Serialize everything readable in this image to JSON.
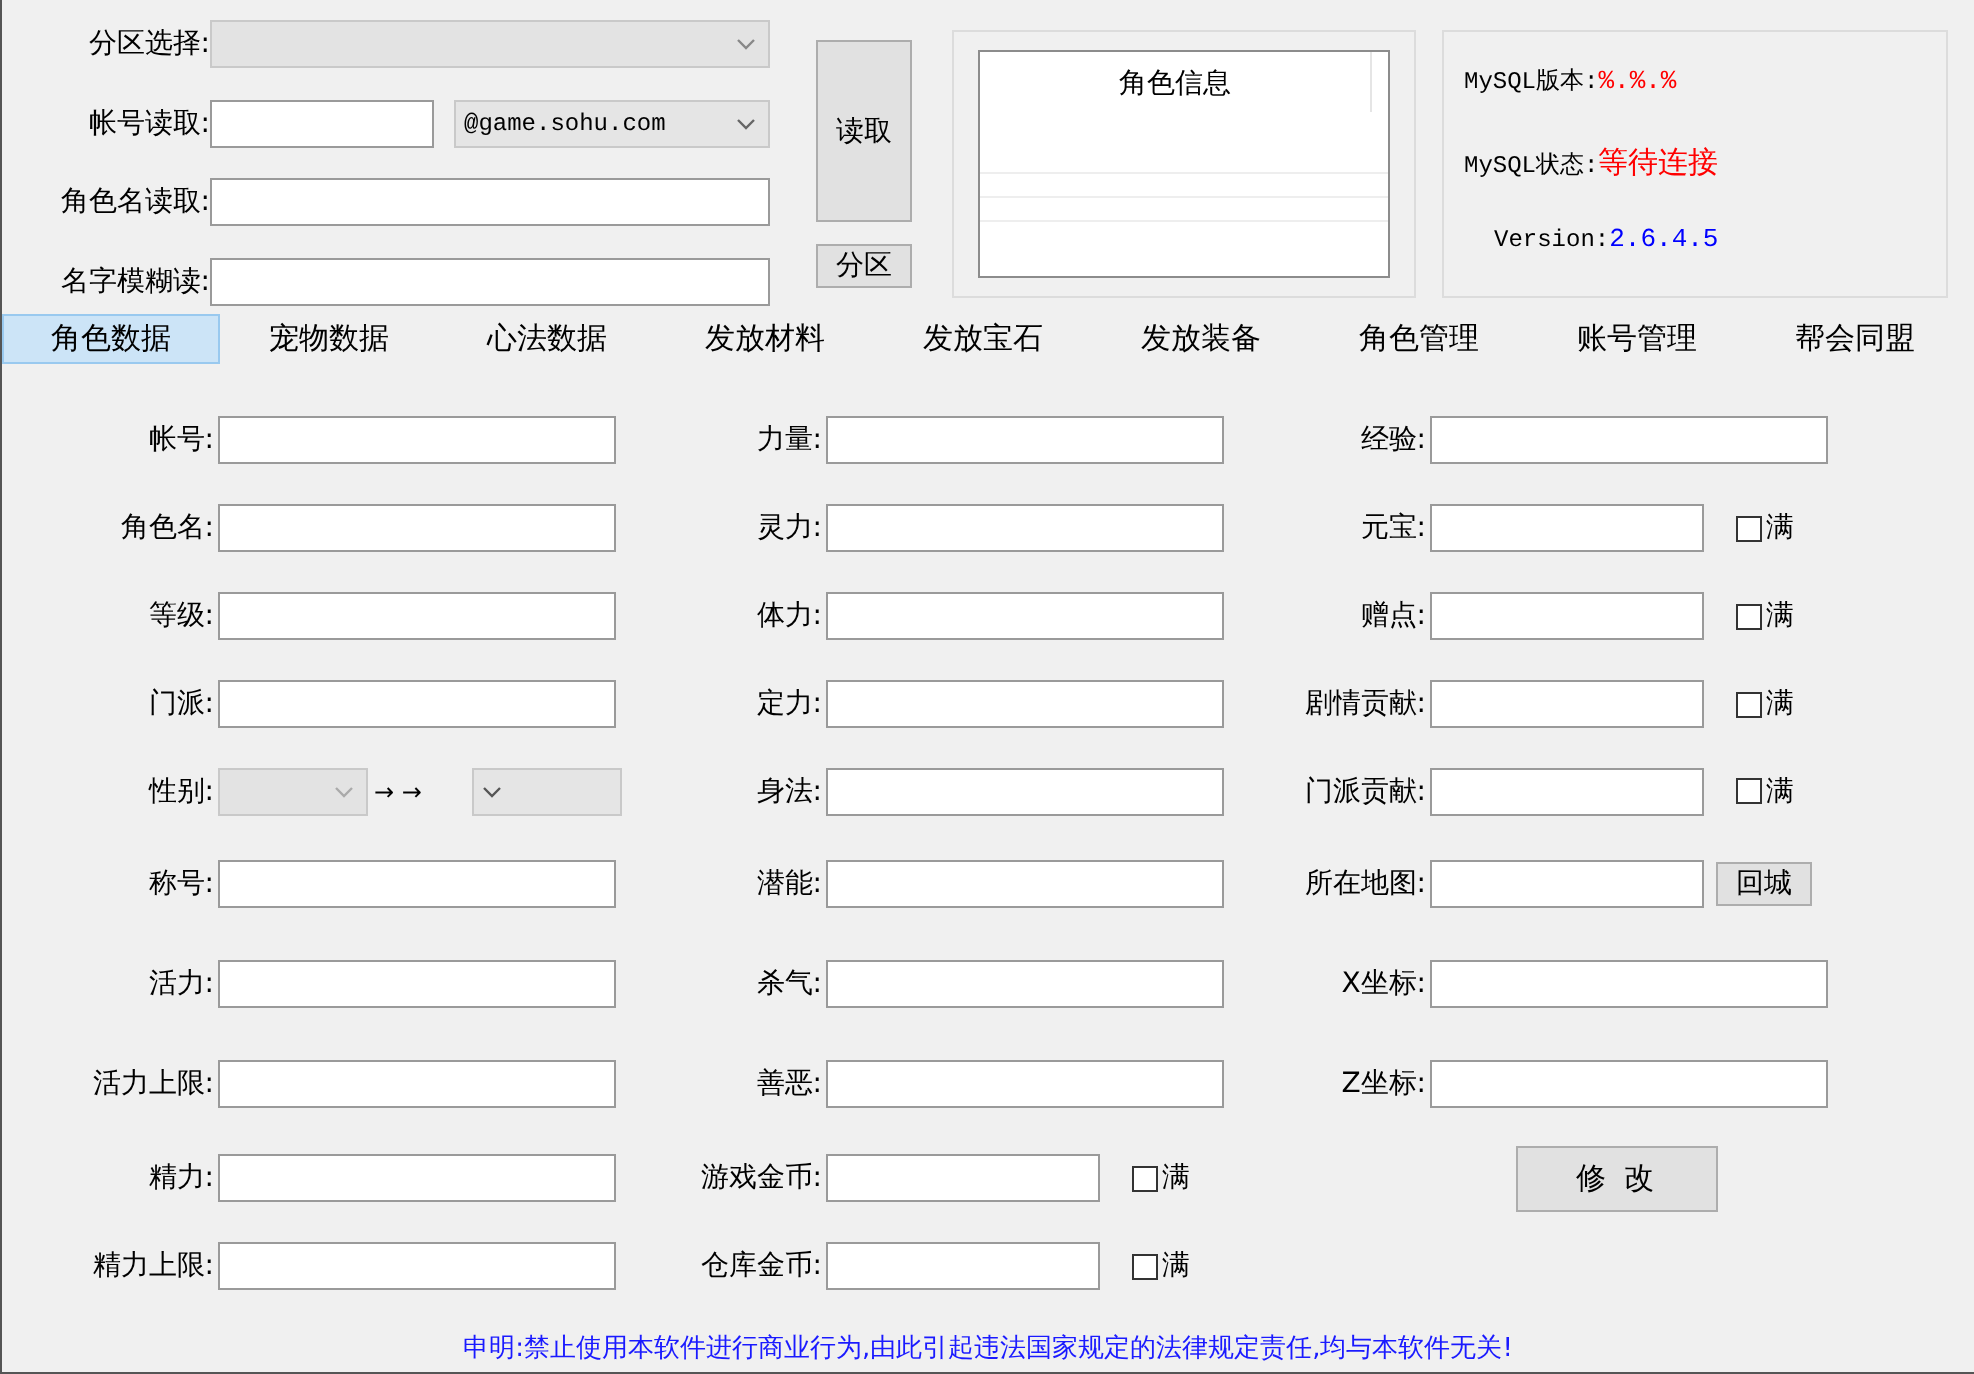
{
  "query": {
    "rows": [
      {
        "label": "分区选择:",
        "kind": "select"
      },
      {
        "label": "帐号读取:",
        "kind": "input-select",
        "select_value": "@game.sohu.com"
      },
      {
        "label": "角色名读取:",
        "kind": "input"
      },
      {
        "label": "名字模糊读:",
        "kind": "input"
      }
    ],
    "read_button": "读取",
    "zone_button": "分区"
  },
  "role_info": {
    "header": "角色信息"
  },
  "server_info": [
    {
      "label": "MySQL版本:",
      "value": "%.%.%",
      "color": "#ff0000"
    },
    {
      "label": "MySQL状态:",
      "value": "等待连接",
      "color": "#ff0000"
    },
    {
      "label": "Version:",
      "value": "2.6.4.5",
      "color": "#0000ff"
    }
  ],
  "tabs": [
    {
      "label": "角色数据",
      "selected": true
    },
    {
      "label": "宠物数据",
      "selected": false
    },
    {
      "label": "心法数据",
      "selected": false
    },
    {
      "label": "发放材料",
      "selected": false
    },
    {
      "label": "发放宝石",
      "selected": false
    },
    {
      "label": "发放装备",
      "selected": false
    },
    {
      "label": "角色管理",
      "selected": false
    },
    {
      "label": "账号管理",
      "selected": false
    },
    {
      "label": "帮会同盟",
      "selected": false
    }
  ],
  "form": {
    "columns": [
      [
        {
          "kind": "text",
          "label": "帐号:"
        },
        {
          "kind": "text",
          "label": "角色名:"
        },
        {
          "kind": "text",
          "label": "等级:"
        },
        {
          "kind": "text",
          "label": "门派:"
        },
        {
          "kind": "select-pair",
          "label": "性别:",
          "arrow": "→ →"
        },
        {
          "kind": "text",
          "label": "称号:"
        },
        {
          "kind": "text",
          "label": "活力:"
        },
        {
          "kind": "text",
          "label": "活力上限:"
        },
        {
          "kind": "text",
          "label": "精力:"
        },
        {
          "kind": "text",
          "label": "精力上限:"
        }
      ],
      [
        {
          "kind": "text",
          "label": "力量:"
        },
        {
          "kind": "text",
          "label": "灵力:"
        },
        {
          "kind": "text",
          "label": "体力:"
        },
        {
          "kind": "text",
          "label": "定力:"
        },
        {
          "kind": "text",
          "label": "身法:"
        },
        {
          "kind": "text",
          "label": "潜能:"
        },
        {
          "kind": "text",
          "label": "杀气:"
        },
        {
          "kind": "text",
          "label": "善恶:"
        },
        {
          "kind": "check",
          "label": "游戏金币:",
          "check_label": "满",
          "checked": false
        },
        {
          "kind": "check",
          "label": "仓库金币:",
          "check_label": "满",
          "checked": false
        }
      ],
      [
        {
          "kind": "text",
          "label": "经验:"
        },
        {
          "kind": "check",
          "label": "元宝:",
          "check_label": "满",
          "checked": false
        },
        {
          "kind": "check",
          "label": "赠点:",
          "check_label": "满",
          "checked": false
        },
        {
          "kind": "check",
          "label": "剧情贡献:",
          "check_label": "满",
          "checked": false
        },
        {
          "kind": "check",
          "label": "门派贡献:",
          "check_label": "满",
          "checked": false
        },
        {
          "kind": "button",
          "label": "所在地图:",
          "button": "回城"
        },
        {
          "kind": "text",
          "label": "X坐标:"
        },
        {
          "kind": "text",
          "label": "Z坐标:"
        },
        {
          "kind": "action",
          "button": "修 改"
        }
      ]
    ]
  },
  "notice": "申明:禁止使用本软件进行商业行为,由此引起违法国家规定的法律规定责任,均与本软件无关!"
}
